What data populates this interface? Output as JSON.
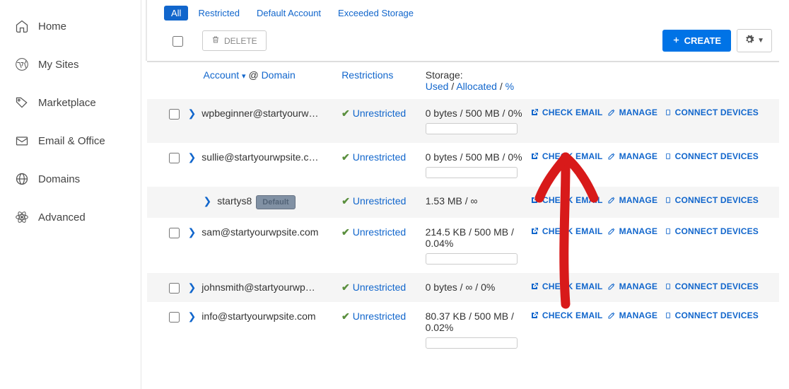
{
  "sidebar": {
    "items": [
      {
        "label": "Home"
      },
      {
        "label": "My Sites"
      },
      {
        "label": "Marketplace"
      },
      {
        "label": "Email & Office"
      },
      {
        "label": "Domains"
      },
      {
        "label": "Advanced"
      }
    ]
  },
  "tabs": [
    {
      "label": "All",
      "active": true
    },
    {
      "label": "Restricted"
    },
    {
      "label": "Default Account"
    },
    {
      "label": "Exceeded Storage"
    }
  ],
  "toolbar": {
    "delete_label": "DELETE",
    "create_label": "CREATE"
  },
  "columns": {
    "account": "Account",
    "at": "@",
    "domain": "Domain",
    "restrictions": "Restrictions",
    "storage_label": "Storage:",
    "used": "Used",
    "allocated": "Allocated",
    "percent": "%"
  },
  "actions": {
    "check_email": "CHECK EMAIL",
    "manage": "MANAGE",
    "connect": "CONNECT DEVICES"
  },
  "rows": [
    {
      "account": "wpbeginner@startyourw…",
      "restriction": "Unrestricted",
      "storage": "0 bytes / 500 MB / 0%",
      "progress": true,
      "checkbox": true
    },
    {
      "account": "sullie@startyourwpsite.c…",
      "restriction": "Unrestricted",
      "storage": "0 bytes / 500 MB / 0%",
      "progress": true,
      "checkbox": true
    },
    {
      "account": "startys8",
      "restriction": "Unrestricted",
      "storage": "1.53 MB / ∞",
      "progress": false,
      "checkbox": false,
      "default_badge": "Default",
      "indent": true
    },
    {
      "account": "sam@startyourwpsite.com",
      "restriction": "Unrestricted",
      "storage": "214.5 KB / 500 MB / 0.04%",
      "progress": true,
      "checkbox": true
    },
    {
      "account": "johnsmith@startyourwp…",
      "restriction": "Unrestricted",
      "storage": "0 bytes / ∞ / 0%",
      "progress": false,
      "checkbox": true
    },
    {
      "account": "info@startyourwpsite.com",
      "restriction": "Unrestricted",
      "storage": "80.37 KB / 500 MB / 0.02%",
      "progress": true,
      "checkbox": true
    }
  ]
}
